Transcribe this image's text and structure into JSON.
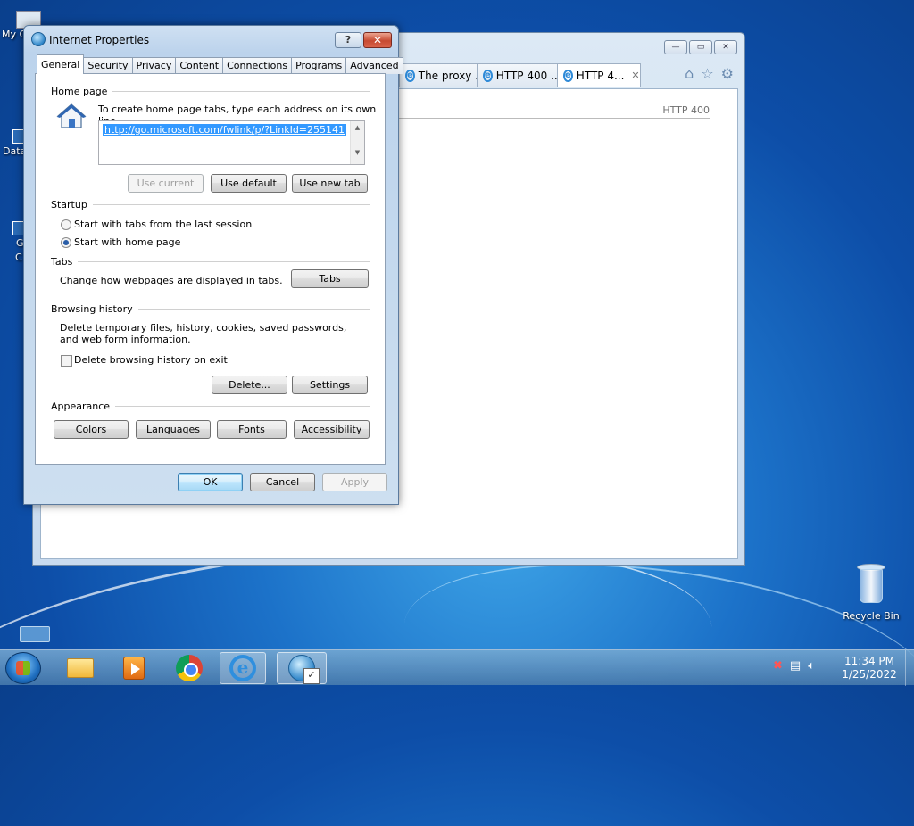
{
  "desktop": {
    "left_icon_labels": [
      "My C",
      "Data",
      "G",
      "C"
    ],
    "recycle_bin_label": "Recycle Bin"
  },
  "browser": {
    "tabs": [
      {
        "label": "The proxy ..."
      },
      {
        "label": "HTTP 400 ..."
      },
      {
        "label": "HTTP 4...",
        "close": "✕"
      }
    ],
    "window_buttons": {
      "minimize": "—",
      "restore": "▭",
      "close": "✕"
    },
    "content_heading": "HTTP 400"
  },
  "dialog": {
    "title": "Internet Properties",
    "help_button": "?",
    "close_button": "✕",
    "tabs": [
      "General",
      "Security",
      "Privacy",
      "Content",
      "Connections",
      "Programs",
      "Advanced"
    ],
    "active_tab": "General",
    "home_page": {
      "heading": "Home page",
      "instruction": "To create home page tabs, type each address on its own line.",
      "url": "http://go.microsoft.com/fwlink/p/?LinkId=255141",
      "use_current": "Use current",
      "use_default": "Use default",
      "use_new_tab": "Use new tab"
    },
    "startup": {
      "heading": "Startup",
      "option_last_session": "Start with tabs from the last session",
      "option_home_page": "Start with home page",
      "selected": "home_page"
    },
    "tabs_section": {
      "heading": "Tabs",
      "description": "Change how webpages are displayed in tabs.",
      "button": "Tabs"
    },
    "browsing_history": {
      "heading": "Browsing history",
      "description": "Delete temporary files, history, cookies, saved passwords, and web form information.",
      "delete_on_exit": "Delete browsing history on exit",
      "delete_on_exit_checked": false,
      "delete_button": "Delete...",
      "settings_button": "Settings"
    },
    "appearance": {
      "heading": "Appearance",
      "colors": "Colors",
      "languages": "Languages",
      "fonts": "Fonts",
      "accessibility": "Accessibility"
    },
    "footer": {
      "ok": "OK",
      "cancel": "Cancel",
      "apply": "Apply"
    }
  },
  "taskbar": {
    "apps": [
      "windows-explorer",
      "media-player",
      "chrome",
      "internet-explorer",
      "internet-properties"
    ],
    "tray_icons": [
      "network-error-icon",
      "action-center-icon",
      "volume-icon"
    ],
    "time": "11:34 PM",
    "date": "1/25/2022"
  }
}
